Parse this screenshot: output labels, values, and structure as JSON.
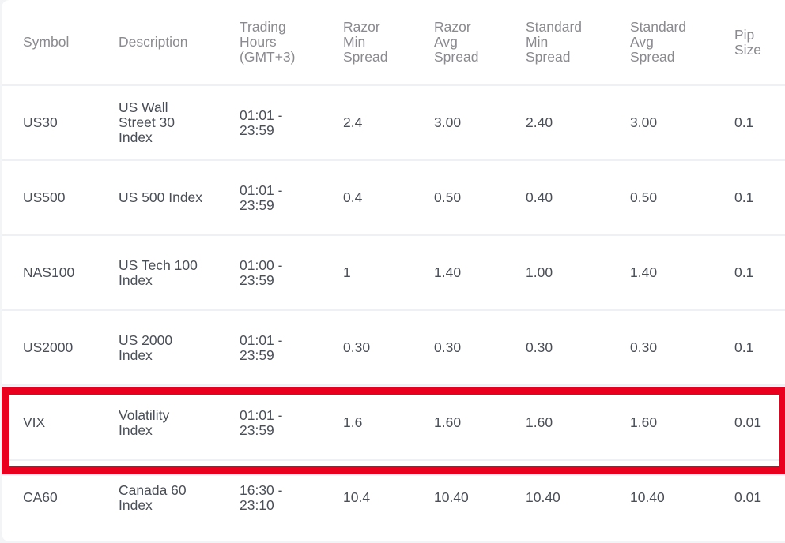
{
  "table": {
    "headers": [
      "Symbol",
      "Description",
      "Trading Hours (GMT+3)",
      "Razor Min Spread",
      "Razor Avg Spread",
      "Standard Min Spread",
      "Standard Avg Spread",
      "Pip Size"
    ],
    "rows": [
      [
        "US30",
        "US Wall Street 30 Index",
        "01:01 - 23:59",
        "2.4",
        "3.00",
        "2.40",
        "3.00",
        "0.1"
      ],
      [
        "US500",
        "US 500 Index",
        "01:01 - 23:59",
        "0.4",
        "0.50",
        "0.40",
        "0.50",
        "0.1"
      ],
      [
        "NAS100",
        "US Tech 100 Index",
        "01:00 - 23:59",
        "1",
        "1.40",
        "1.00",
        "1.40",
        "0.1"
      ],
      [
        "US2000",
        "US 2000 Index",
        "01:01 - 23:59",
        "0.30",
        "0.30",
        "0.30",
        "0.30",
        "0.1"
      ],
      [
        "VIX",
        "Volatility Index",
        "01:01 - 23:59",
        "1.6",
        "1.60",
        "1.60",
        "1.60",
        "0.01"
      ],
      [
        "CA60",
        "Canada 60 Index",
        "16:30 - 23:10",
        "10.4",
        "10.40",
        "10.40",
        "10.40",
        "0.01"
      ]
    ],
    "highlighted_row": "VIX",
    "highlight_color": "#e8001e"
  }
}
